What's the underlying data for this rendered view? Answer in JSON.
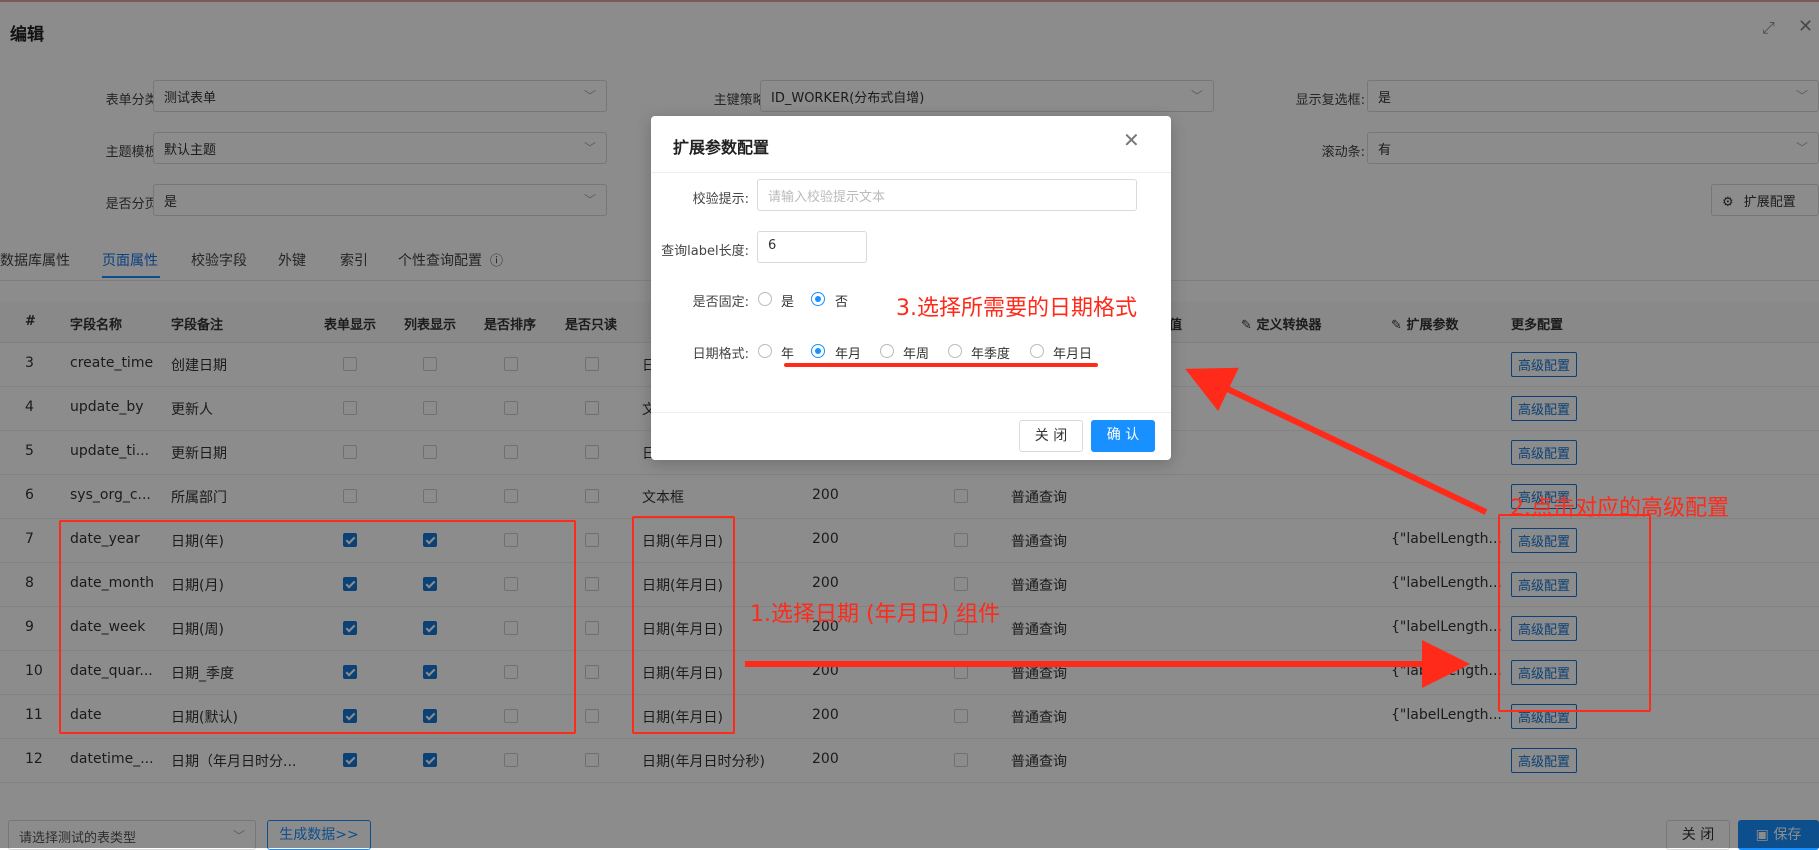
{
  "window": {
    "title": "编辑",
    "maximize_icon": "expand-icon",
    "close_icon": "close-icon"
  },
  "form": {
    "row1": [
      {
        "label": "表单分类:",
        "value": "测试表单"
      },
      {
        "label": "主键策略:",
        "value": "ID_WORKER(分布式自增)"
      },
      {
        "label": "显示复选框:",
        "value": "是"
      }
    ],
    "row2": [
      {
        "label": "主题模板:",
        "value": "默认主题"
      },
      {
        "label": "滚动条:",
        "value": "有"
      }
    ],
    "row3": [
      {
        "label": "是否分页:",
        "value": "是"
      }
    ],
    "ext_config_button": "扩展配置"
  },
  "tabs": [
    "数据库属性",
    "页面属性",
    "校验字段",
    "外键",
    "索引",
    "个性查询配置"
  ],
  "active_tab": "页面属性",
  "table": {
    "headers": {
      "idx": "#",
      "name": "字段名称",
      "remark": "字段备注",
      "form_show": "表单显示",
      "list_show": "列表显示",
      "sort": "是否排序",
      "readonly": "是否只读",
      "default": "默认值",
      "converter": "定义转换器",
      "ext_param": "扩展参数",
      "more": "更多配置"
    },
    "rows": [
      {
        "idx": "3",
        "name": "create_time",
        "remark": "创建日期",
        "form": false,
        "list": false,
        "type": "日",
        "len": "",
        "query": "",
        "ext": ""
      },
      {
        "idx": "4",
        "name": "update_by",
        "remark": "更新人",
        "form": false,
        "list": false,
        "type": "文",
        "len": "",
        "query": "",
        "ext": ""
      },
      {
        "idx": "5",
        "name": "update_ti...",
        "remark": "更新日期",
        "form": false,
        "list": false,
        "type": "日",
        "len": "",
        "query": "",
        "ext": ""
      },
      {
        "idx": "6",
        "name": "sys_org_c...",
        "remark": "所属部门",
        "form": false,
        "list": false,
        "type": "文本框",
        "len": "200",
        "query": "普通查询",
        "ext": ""
      },
      {
        "idx": "7",
        "name": "date_year",
        "remark": "日期(年)",
        "form": true,
        "list": true,
        "type": "日期(年月日)",
        "len": "200",
        "query": "普通查询",
        "ext": "{\"labelLength..."
      },
      {
        "idx": "8",
        "name": "date_month",
        "remark": "日期(月)",
        "form": true,
        "list": true,
        "type": "日期(年月日)",
        "len": "200",
        "query": "普通查询",
        "ext": "{\"labelLength..."
      },
      {
        "idx": "9",
        "name": "date_week",
        "remark": "日期(周)",
        "form": true,
        "list": true,
        "type": "日期(年月日)",
        "len": "200",
        "query": "普通查询",
        "ext": "{\"labelLength..."
      },
      {
        "idx": "10",
        "name": "date_quar...",
        "remark": "日期_季度",
        "form": true,
        "list": true,
        "type": "日期(年月日)",
        "len": "200",
        "query": "普通查询",
        "ext": "{\"labelLength..."
      },
      {
        "idx": "11",
        "name": "date",
        "remark": "日期(默认)",
        "form": true,
        "list": true,
        "type": "日期(年月日)",
        "len": "200",
        "query": "普通查询",
        "ext": "{\"labelLength..."
      },
      {
        "idx": "12",
        "name": "datetime_...",
        "remark": "日期（年月日时分...",
        "form": true,
        "list": true,
        "type": "日期(年月日时分秒)",
        "len": "200",
        "query": "普通查询",
        "ext": ""
      }
    ],
    "advanced_label": "高级配置"
  },
  "footer": {
    "select_placeholder": "请选择测试的表类型",
    "generate": "生成数据>>",
    "close": "关 闭",
    "save": "保存"
  },
  "modal": {
    "title": "扩展参数配置",
    "validate_label": "校验提示:",
    "validate_placeholder": "请输入校验提示文本",
    "label_len_label": "查询label长度:",
    "label_len_value": "6",
    "fixed_label": "是否固定:",
    "fixed_options": [
      "是",
      "否"
    ],
    "fixed_selected": "否",
    "date_format_label": "日期格式:",
    "date_options": [
      "年",
      "年月",
      "年周",
      "年季度",
      "年月日"
    ],
    "date_selected": "年月",
    "close": "关 闭",
    "confirm": "确 认"
  },
  "annotations": {
    "step1": "1.选择日期 (年月日) 组件",
    "step2": "2.点击对应的高级配置",
    "step3": "3.选择所需要的日期格式"
  },
  "colors": {
    "primary": "#1890ff",
    "annotation": "#ff2a1a"
  }
}
